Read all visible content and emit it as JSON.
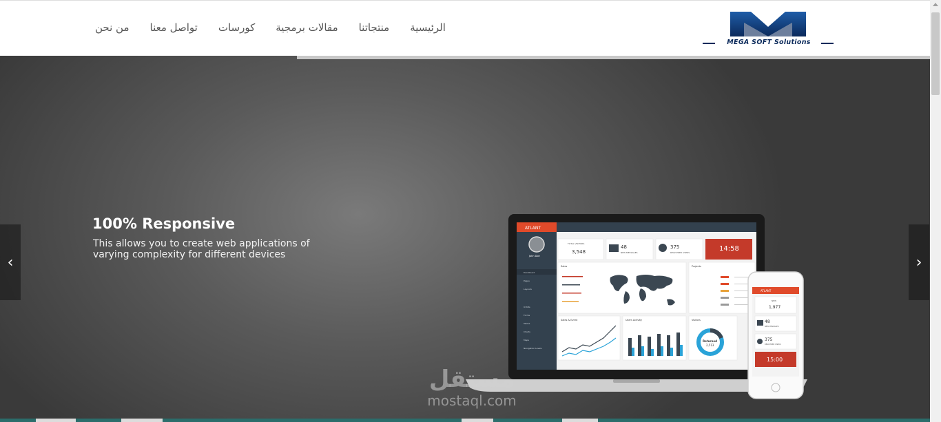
{
  "header": {
    "logo_text": "MEGA SOFT Solutions",
    "nav": [
      {
        "label": "من نحن"
      },
      {
        "label": "تواصل معنا"
      },
      {
        "label": "كورسات"
      },
      {
        "label": "مقالات برمجية"
      },
      {
        "label": "منتجاتنا"
      },
      {
        "label": "الرئيسية"
      }
    ]
  },
  "hero": {
    "title": "100% Responsive",
    "description": "This allows you to create web applications of varying complexity for different devices",
    "prev_icon": "chevron-left-icon",
    "next_icon": "chevron-right-icon",
    "prev_glyph": "‹",
    "next_glyph": "›"
  },
  "dashboard": {
    "brand": "ATLANT",
    "user_name": "John Doe",
    "stats": [
      {
        "label": "TOTAL VISITORS",
        "value": "3,548"
      },
      {
        "label": "NEW MESSAGES",
        "value": "48"
      },
      {
        "label": "REGISTRED USERS",
        "value": "375"
      },
      {
        "label": "CLOCK",
        "value": "14:58"
      }
    ],
    "menu": [
      "Dashboard",
      "Pages",
      "Layouts",
      "UI Kits",
      "Forms",
      "Tables",
      "Charts",
      "Maps",
      "Navigation Levels"
    ],
    "panels": [
      "Sales",
      "Projects",
      "Sales & Event",
      "Users Activity",
      "Visitors"
    ],
    "donut_label": "Returned",
    "donut_value": "2,513"
  },
  "phone": {
    "brand": "ATLANT",
    "stats": [
      {
        "label": "NEW",
        "value": "1,977"
      },
      {
        "label": "NEW MESSAGES",
        "value": "48"
      },
      {
        "label": "REGISTRED USERS",
        "value": "375"
      },
      {
        "label": "CLOCK",
        "value": "15:00"
      }
    ]
  },
  "watermark": {
    "arabic": "مستقل",
    "latin": "mostaql.com"
  },
  "colors": {
    "accent_red": "#e04a2a",
    "navy": "#0b2a5b",
    "logo_blue": "#1e5aa8"
  }
}
